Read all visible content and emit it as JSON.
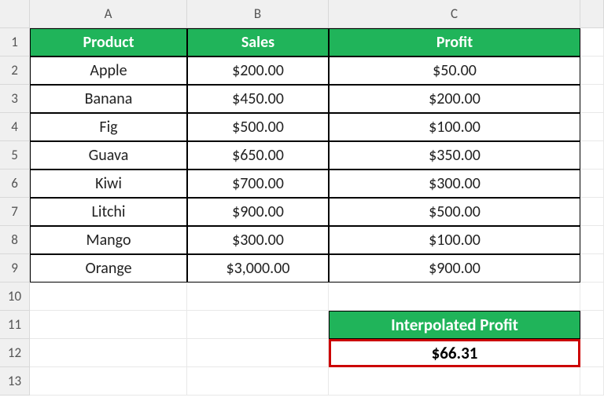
{
  "columns": [
    "A",
    "B",
    "C"
  ],
  "rows": [
    "1",
    "2",
    "3",
    "4",
    "5",
    "6",
    "7",
    "8",
    "9",
    "10",
    "11",
    "12",
    "13"
  ],
  "headers": {
    "product": "Product",
    "sales": "Sales",
    "profit": "Profit"
  },
  "data": [
    {
      "product": "Apple",
      "sales": "$200.00",
      "profit": "$50.00"
    },
    {
      "product": "Banana",
      "sales": "$450.00",
      "profit": "$200.00"
    },
    {
      "product": "Fig",
      "sales": "$500.00",
      "profit": "$100.00"
    },
    {
      "product": "Guava",
      "sales": "$650.00",
      "profit": "$350.00"
    },
    {
      "product": "Kiwi",
      "sales": "$700.00",
      "profit": "$300.00"
    },
    {
      "product": "Litchi",
      "sales": "$900.00",
      "profit": "$500.00"
    },
    {
      "product": "Mango",
      "sales": "$300.00",
      "profit": "$100.00"
    },
    {
      "product": "Orange",
      "sales": "$3,000.00",
      "profit": "$900.00"
    }
  ],
  "interpolated": {
    "label": "Interpolated Profit",
    "value": "$66.31"
  }
}
